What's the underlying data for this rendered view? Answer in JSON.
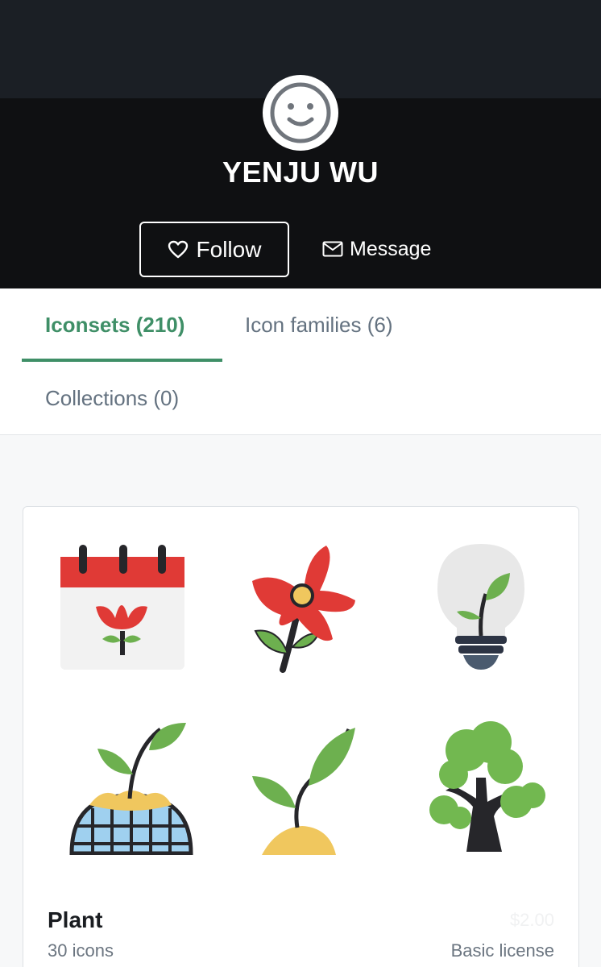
{
  "profile": {
    "name": "YENJU WU",
    "follow_label": "Follow",
    "message_label": "Message",
    "avatar_icon": "smiley-face-icon"
  },
  "tabs": [
    {
      "label": "Iconsets (210)",
      "active": true
    },
    {
      "label": "Icon families (6)",
      "active": false
    },
    {
      "label": "Collections (0)",
      "active": false
    }
  ],
  "iconset": {
    "title": "Plant",
    "count": "30 icons",
    "price": "$2.00",
    "license": "Basic license",
    "icons": [
      "calendar-flower-icon",
      "red-flower-icon",
      "plant-lightbulb-icon",
      "globe-sprout-icon",
      "sprout-soil-icon",
      "tree-icon"
    ]
  },
  "colors": {
    "accent": "#3f8f67",
    "header_dark": "#0f1012",
    "header_top": "#1b1f25"
  }
}
